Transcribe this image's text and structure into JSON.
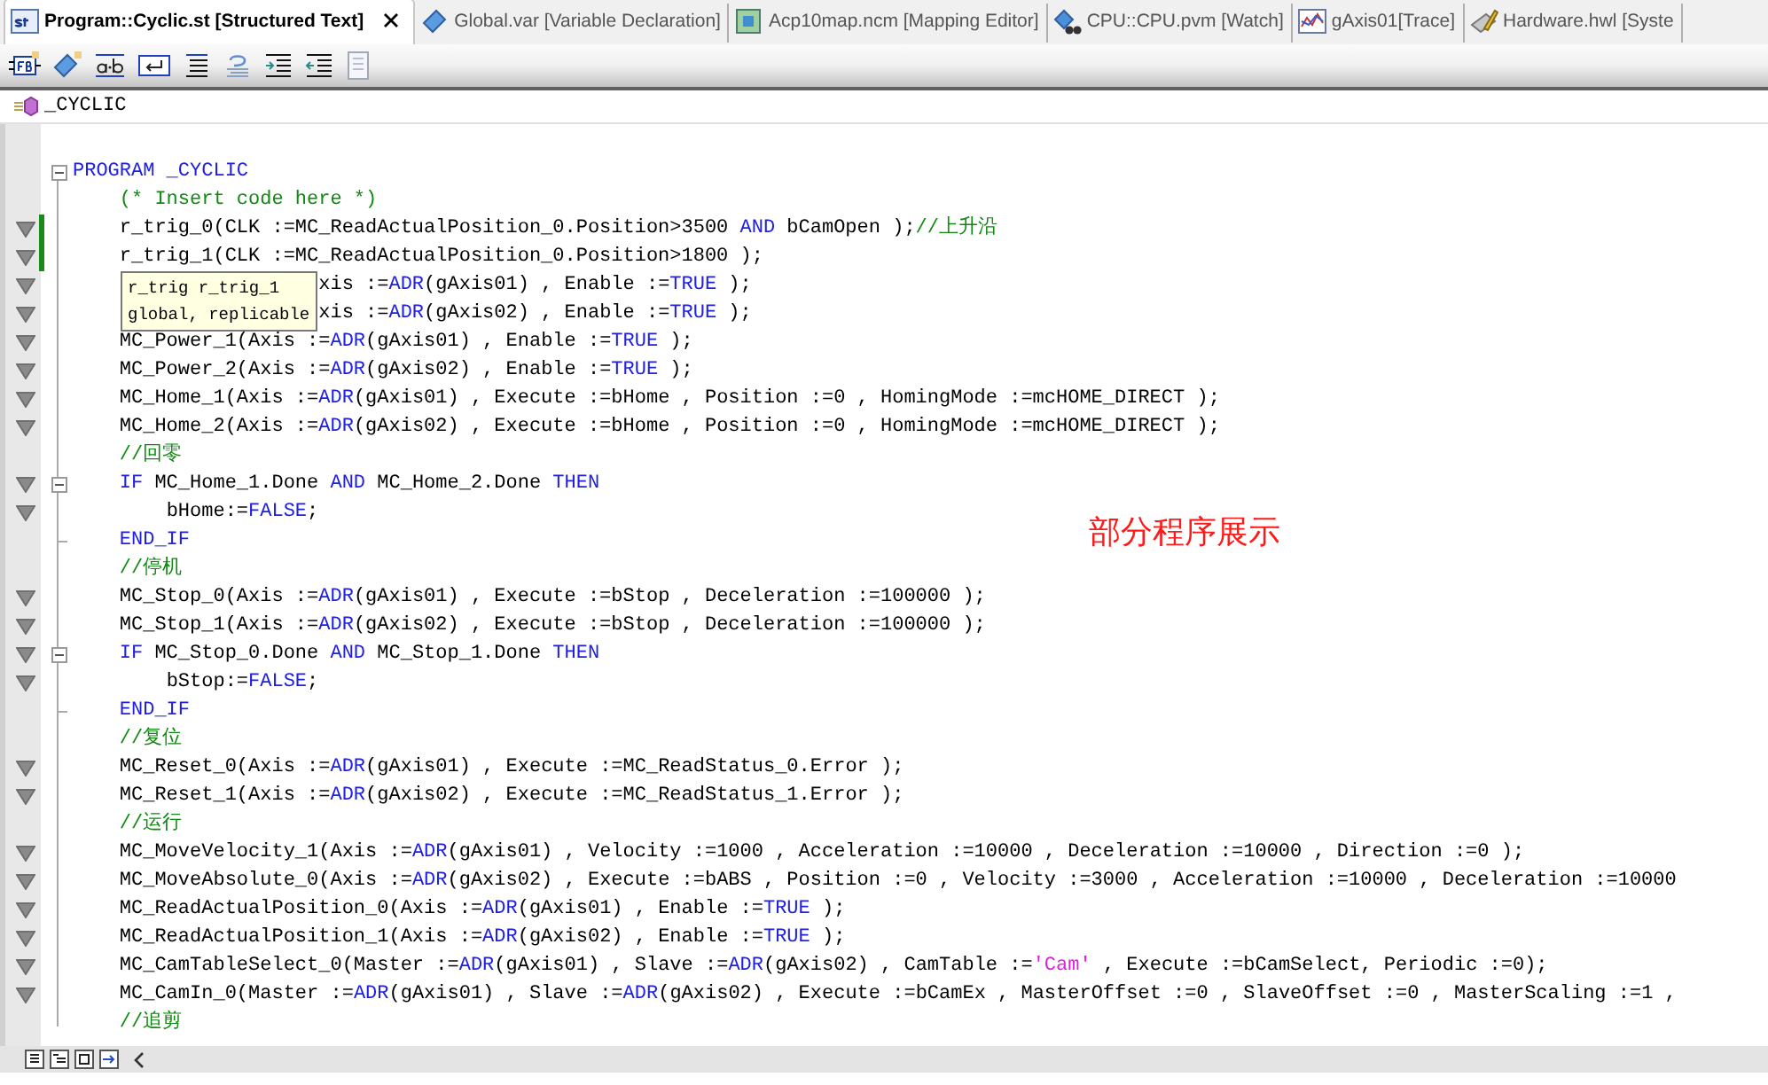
{
  "tabs": [
    {
      "label": "Program::Cyclic.st [Structured Text]",
      "selected": true
    },
    {
      "label": "Global.var [Variable Declaration]",
      "selected": false
    },
    {
      "label": "Acp10map.ncm [Mapping Editor]",
      "selected": false
    },
    {
      "label": "CPU::CPU.pvm [Watch]",
      "selected": false
    },
    {
      "label": "gAxis01[Trace]",
      "selected": false
    },
    {
      "label": "Hardware.hwl [Syste",
      "selected": false
    }
  ],
  "header": {
    "title": "_CYCLIC"
  },
  "editor": {
    "lines": [
      {
        "marker": false,
        "changed": false,
        "fold_start": true,
        "fold_end": false,
        "tokens": [
          {
            "kind": "keyword",
            "text": "PROGRAM _CYCLIC"
          }
        ]
      },
      {
        "marker": false,
        "changed": false,
        "fold_start": false,
        "fold_end": false,
        "tokens": [
          {
            "kind": "comment",
            "text": "    (* Insert code here *)"
          }
        ]
      },
      {
        "marker": true,
        "changed": true,
        "fold_start": false,
        "fold_end": false,
        "tokens": [
          {
            "kind": "plain",
            "text": "    r_trig_0(CLK :=MC_ReadActualPosition_0.Position>3500 "
          },
          {
            "kind": "keyword",
            "text": "AND"
          },
          {
            "kind": "plain",
            "text": " bCamOpen );"
          },
          {
            "kind": "comment",
            "text": "//上升沿"
          }
        ]
      },
      {
        "marker": true,
        "changed": true,
        "fold_start": false,
        "fold_end": false,
        "tokens": [
          {
            "kind": "plain",
            "text": "    r_trig_1(CLK :=MC_ReadActualPosition_0.Position>1800 );"
          }
        ]
      },
      {
        "marker": true,
        "changed": false,
        "fold_start": false,
        "fold_end": false,
        "tokens": [
          {
            "kind": "plain",
            "text": "                     xis :="
          },
          {
            "kind": "keyword",
            "text": "ADR"
          },
          {
            "kind": "plain",
            "text": "(gAxis01) , Enable :="
          },
          {
            "kind": "keyword",
            "text": "TRUE"
          },
          {
            "kind": "plain",
            "text": " );"
          }
        ]
      },
      {
        "marker": true,
        "changed": false,
        "fold_start": false,
        "fold_end": false,
        "tokens": [
          {
            "kind": "plain",
            "text": "                     xis :="
          },
          {
            "kind": "keyword",
            "text": "ADR"
          },
          {
            "kind": "plain",
            "text": "(gAxis02) , Enable :="
          },
          {
            "kind": "keyword",
            "text": "TRUE"
          },
          {
            "kind": "plain",
            "text": " );"
          }
        ]
      },
      {
        "marker": true,
        "changed": false,
        "fold_start": false,
        "fold_end": false,
        "tokens": [
          {
            "kind": "plain",
            "text": "    MC_Power_1(Axis :="
          },
          {
            "kind": "keyword",
            "text": "ADR"
          },
          {
            "kind": "plain",
            "text": "(gAxis01) , Enable :="
          },
          {
            "kind": "keyword",
            "text": "TRUE"
          },
          {
            "kind": "plain",
            "text": " );"
          }
        ]
      },
      {
        "marker": true,
        "changed": false,
        "fold_start": false,
        "fold_end": false,
        "tokens": [
          {
            "kind": "plain",
            "text": "    MC_Power_2(Axis :="
          },
          {
            "kind": "keyword",
            "text": "ADR"
          },
          {
            "kind": "plain",
            "text": "(gAxis02) , Enable :="
          },
          {
            "kind": "keyword",
            "text": "TRUE"
          },
          {
            "kind": "plain",
            "text": " );"
          }
        ]
      },
      {
        "marker": true,
        "changed": false,
        "fold_start": false,
        "fold_end": false,
        "tokens": [
          {
            "kind": "plain",
            "text": "    MC_Home_1(Axis :="
          },
          {
            "kind": "keyword",
            "text": "ADR"
          },
          {
            "kind": "plain",
            "text": "(gAxis01) , Execute :=bHome , Position :=0 , HomingMode :=mcHOME_DIRECT );"
          }
        ]
      },
      {
        "marker": true,
        "changed": false,
        "fold_start": false,
        "fold_end": false,
        "tokens": [
          {
            "kind": "plain",
            "text": "    MC_Home_2(Axis :="
          },
          {
            "kind": "keyword",
            "text": "ADR"
          },
          {
            "kind": "plain",
            "text": "(gAxis02) , Execute :=bHome , Position :=0 , HomingMode :=mcHOME_DIRECT );"
          }
        ]
      },
      {
        "marker": false,
        "changed": false,
        "fold_start": false,
        "fold_end": false,
        "tokens": [
          {
            "kind": "comment",
            "text": "    //回零"
          }
        ]
      },
      {
        "marker": true,
        "changed": false,
        "fold_start": true,
        "fold_end": false,
        "tokens": [
          {
            "kind": "keyword",
            "text": "    IF"
          },
          {
            "kind": "plain",
            "text": " MC_Home_1.Done "
          },
          {
            "kind": "keyword",
            "text": "AND"
          },
          {
            "kind": "plain",
            "text": " MC_Home_2.Done "
          },
          {
            "kind": "keyword",
            "text": "THEN"
          }
        ]
      },
      {
        "marker": true,
        "changed": false,
        "fold_start": false,
        "fold_end": false,
        "tokens": [
          {
            "kind": "plain",
            "text": "        bHome:="
          },
          {
            "kind": "keyword",
            "text": "FALSE"
          },
          {
            "kind": "plain",
            "text": ";"
          }
        ]
      },
      {
        "marker": false,
        "changed": false,
        "fold_start": false,
        "fold_end": true,
        "tokens": [
          {
            "kind": "keyword",
            "text": "    END_IF"
          }
        ]
      },
      {
        "marker": false,
        "changed": false,
        "fold_start": false,
        "fold_end": false,
        "tokens": [
          {
            "kind": "comment",
            "text": "    //停机"
          }
        ]
      },
      {
        "marker": true,
        "changed": false,
        "fold_start": false,
        "fold_end": false,
        "tokens": [
          {
            "kind": "plain",
            "text": "    MC_Stop_0(Axis :="
          },
          {
            "kind": "keyword",
            "text": "ADR"
          },
          {
            "kind": "plain",
            "text": "(gAxis01) , Execute :=bStop , Deceleration :=100000 );"
          }
        ]
      },
      {
        "marker": true,
        "changed": false,
        "fold_start": false,
        "fold_end": false,
        "tokens": [
          {
            "kind": "plain",
            "text": "    MC_Stop_1(Axis :="
          },
          {
            "kind": "keyword",
            "text": "ADR"
          },
          {
            "kind": "plain",
            "text": "(gAxis02) , Execute :=bStop , Deceleration :=100000 );"
          }
        ]
      },
      {
        "marker": true,
        "changed": false,
        "fold_start": true,
        "fold_end": false,
        "tokens": [
          {
            "kind": "keyword",
            "text": "    IF"
          },
          {
            "kind": "plain",
            "text": " MC_Stop_0.Done "
          },
          {
            "kind": "keyword",
            "text": "AND"
          },
          {
            "kind": "plain",
            "text": " MC_Stop_1.Done "
          },
          {
            "kind": "keyword",
            "text": "THEN"
          }
        ]
      },
      {
        "marker": true,
        "changed": false,
        "fold_start": false,
        "fold_end": false,
        "tokens": [
          {
            "kind": "plain",
            "text": "        bStop:="
          },
          {
            "kind": "keyword",
            "text": "FALSE"
          },
          {
            "kind": "plain",
            "text": ";"
          }
        ]
      },
      {
        "marker": false,
        "changed": false,
        "fold_start": false,
        "fold_end": true,
        "tokens": [
          {
            "kind": "keyword",
            "text": "    END_IF"
          }
        ]
      },
      {
        "marker": false,
        "changed": false,
        "fold_start": false,
        "fold_end": false,
        "tokens": [
          {
            "kind": "comment",
            "text": "    //复位"
          }
        ]
      },
      {
        "marker": true,
        "changed": false,
        "fold_start": false,
        "fold_end": false,
        "tokens": [
          {
            "kind": "plain",
            "text": "    MC_Reset_0(Axis :="
          },
          {
            "kind": "keyword",
            "text": "ADR"
          },
          {
            "kind": "plain",
            "text": "(gAxis01) , Execute :=MC_ReadStatus_0.Error );"
          }
        ]
      },
      {
        "marker": true,
        "changed": false,
        "fold_start": false,
        "fold_end": false,
        "tokens": [
          {
            "kind": "plain",
            "text": "    MC_Reset_1(Axis :="
          },
          {
            "kind": "keyword",
            "text": "ADR"
          },
          {
            "kind": "plain",
            "text": "(gAxis02) , Execute :=MC_ReadStatus_1.Error );"
          }
        ]
      },
      {
        "marker": false,
        "changed": false,
        "fold_start": false,
        "fold_end": false,
        "tokens": [
          {
            "kind": "comment",
            "text": "    //运行"
          }
        ]
      },
      {
        "marker": true,
        "changed": false,
        "fold_start": false,
        "fold_end": false,
        "tokens": [
          {
            "kind": "plain",
            "text": "    MC_MoveVelocity_1(Axis :="
          },
          {
            "kind": "keyword",
            "text": "ADR"
          },
          {
            "kind": "plain",
            "text": "(gAxis01) , Velocity :=1000 , Acceleration :=10000 , Deceleration :=10000 , Direction :=0 );"
          }
        ]
      },
      {
        "marker": true,
        "changed": false,
        "fold_start": false,
        "fold_end": false,
        "tokens": [
          {
            "kind": "plain",
            "text": "    MC_MoveAbsolute_0(Axis :="
          },
          {
            "kind": "keyword",
            "text": "ADR"
          },
          {
            "kind": "plain",
            "text": "(gAxis02) , Execute :=bABS , Position :=0 , Velocity :=3000 , Acceleration :=10000 , Deceleration :=10000"
          }
        ]
      },
      {
        "marker": true,
        "changed": false,
        "fold_start": false,
        "fold_end": false,
        "tokens": [
          {
            "kind": "plain",
            "text": "    MC_ReadActualPosition_0(Axis :="
          },
          {
            "kind": "keyword",
            "text": "ADR"
          },
          {
            "kind": "plain",
            "text": "(gAxis01) , Enable :="
          },
          {
            "kind": "keyword",
            "text": "TRUE"
          },
          {
            "kind": "plain",
            "text": " );"
          }
        ]
      },
      {
        "marker": true,
        "changed": false,
        "fold_start": false,
        "fold_end": false,
        "tokens": [
          {
            "kind": "plain",
            "text": "    MC_ReadActualPosition_1(Axis :="
          },
          {
            "kind": "keyword",
            "text": "ADR"
          },
          {
            "kind": "plain",
            "text": "(gAxis02) , Enable :="
          },
          {
            "kind": "keyword",
            "text": "TRUE"
          },
          {
            "kind": "plain",
            "text": " );"
          }
        ]
      },
      {
        "marker": true,
        "changed": false,
        "fold_start": false,
        "fold_end": false,
        "tokens": [
          {
            "kind": "plain",
            "text": "    MC_CamTableSelect_0(Master :="
          },
          {
            "kind": "keyword",
            "text": "ADR"
          },
          {
            "kind": "plain",
            "text": "(gAxis01) , Slave :="
          },
          {
            "kind": "keyword",
            "text": "ADR"
          },
          {
            "kind": "plain",
            "text": "(gAxis02) , CamTable :="
          },
          {
            "kind": "string",
            "text": "'Cam'"
          },
          {
            "kind": "plain",
            "text": " , Execute :=bCamSelect, Periodic :=0);"
          }
        ]
      },
      {
        "marker": true,
        "changed": false,
        "fold_start": false,
        "fold_end": false,
        "tokens": [
          {
            "kind": "plain",
            "text": "    MC_CamIn_0(Master :="
          },
          {
            "kind": "keyword",
            "text": "ADR"
          },
          {
            "kind": "plain",
            "text": "(gAxis01) , Slave :="
          },
          {
            "kind": "keyword",
            "text": "ADR"
          },
          {
            "kind": "plain",
            "text": "(gAxis02) , Execute :=bCamEx , MasterOffset :=0 , SlaveOffset :=0 , MasterScaling :=1 ,"
          }
        ]
      },
      {
        "marker": false,
        "changed": false,
        "fold_start": false,
        "fold_end": false,
        "tokens": [
          {
            "kind": "comment",
            "text": "    //追剪"
          }
        ]
      }
    ]
  },
  "tooltip": {
    "lines": [
      "r_trig r_trig_1",
      "global, replicable"
    ]
  },
  "annotation": {
    "text": "部分程序展示"
  }
}
